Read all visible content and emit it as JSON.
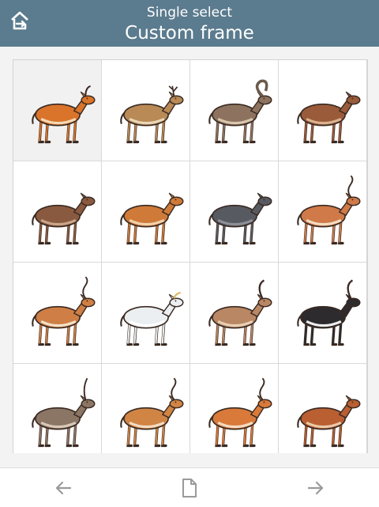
{
  "header": {
    "subtitle": "Single select",
    "title": "Custom frame",
    "home_icon": "home-icon",
    "bar_color": "#5b7b8e"
  },
  "grid": {
    "columns": 4,
    "selected_index": 0,
    "items": [
      {
        "name": "hartebeest-left",
        "body": "#d9742a",
        "belly": "#f3d9b6",
        "horn": "curved"
      },
      {
        "name": "deer-buck",
        "body": "#b98a56",
        "belly": "#e9d7b8",
        "horn": "antler"
      },
      {
        "name": "ibex",
        "body": "#8d735f",
        "belly": "#d9c6ae",
        "horn": "big-curl"
      },
      {
        "name": "bongo-grazing",
        "body": "#9a5b3a",
        "belly": "#d9b38f",
        "horn": "none"
      },
      {
        "name": "duiker",
        "body": "#8a5a40",
        "belly": "#c9a58a",
        "horn": "none"
      },
      {
        "name": "fawn",
        "body": "#cf7a38",
        "belly": "#f1d2ad",
        "horn": "none"
      },
      {
        "name": "tapir-like",
        "body": "#585a62",
        "belly": "#8d8f96",
        "horn": "none"
      },
      {
        "name": "impala",
        "body": "#cf7a48",
        "belly": "#f3dcc3",
        "horn": "lyre"
      },
      {
        "name": "grant-gazelle",
        "body": "#cf7f45",
        "belly": "#f3e1c9",
        "horn": "lyre"
      },
      {
        "name": "mountain-goat",
        "body": "#eceff1",
        "belly": "#ffffff",
        "horn": "small"
      },
      {
        "name": "roan-antelope",
        "body": "#b98764",
        "belly": "#e8d0b6",
        "horn": "curved-back"
      },
      {
        "name": "sable-antelope",
        "body": "#2d2b2e",
        "belly": "#eeeeee",
        "horn": "curved-back"
      },
      {
        "name": "waterbuck",
        "body": "#8b7565",
        "belly": "#d9c8b8",
        "horn": "tall"
      },
      {
        "name": "impala-ram",
        "body": "#d08545",
        "belly": "#f3dcc3",
        "horn": "lyre"
      },
      {
        "name": "kob",
        "body": "#d97a3a",
        "belly": "#f3dcc3",
        "horn": "lyre"
      },
      {
        "name": "puku",
        "body": "#b95f32",
        "belly": "#eac9a8",
        "horn": "none"
      }
    ]
  },
  "footer": {
    "prev_icon": "arrow-left-icon",
    "page_icon": "document-icon",
    "next_icon": "arrow-right-icon",
    "icon_color": "#9a9a9a"
  }
}
